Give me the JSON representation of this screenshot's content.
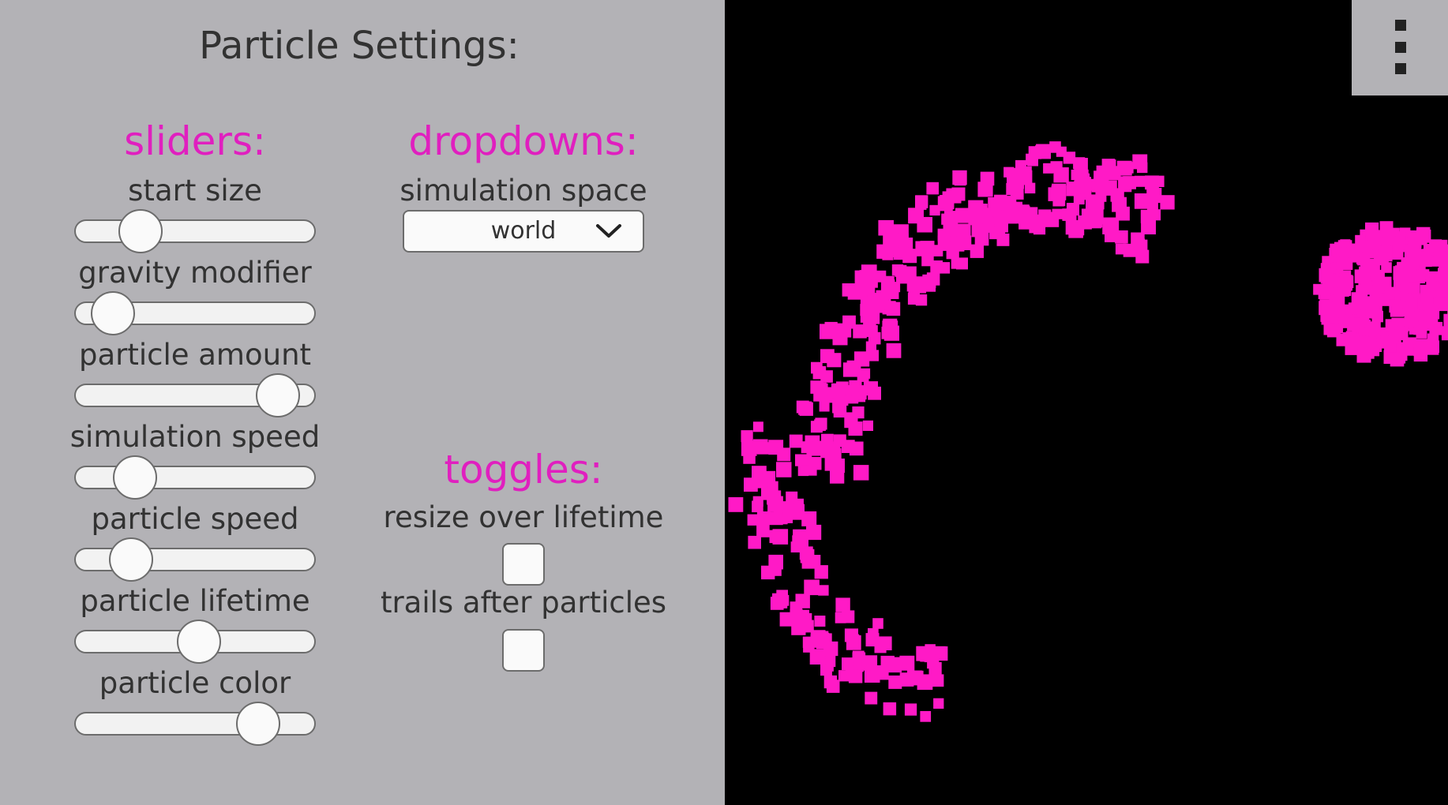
{
  "panel": {
    "title": "Particle Settings:"
  },
  "sliders": {
    "title": "sliders:",
    "items": [
      {
        "label": "start size",
        "value": 0.22
      },
      {
        "label": "gravity modifier",
        "value": 0.08
      },
      {
        "label": "particle amount",
        "value": 0.91
      },
      {
        "label": "simulation speed",
        "value": 0.19
      },
      {
        "label": "particle speed",
        "value": 0.17
      },
      {
        "label": "particle lifetime",
        "value": 0.51
      },
      {
        "label": "particle color",
        "value": 0.81
      }
    ]
  },
  "dropdowns": {
    "title": "dropdowns:",
    "label": "simulation space",
    "value": "world",
    "icon": "chevron-down-icon"
  },
  "toggles": {
    "title": "toggles:",
    "items": [
      {
        "label": "resize over lifetime",
        "checked": false
      },
      {
        "label": "trails after particles",
        "checked": false
      }
    ]
  },
  "viewport": {
    "background": "#000000",
    "particle_color": "#ff1ac6",
    "menu_icon": "kebab-menu-icon"
  },
  "colors": {
    "panel_bg": "#b3b2b6",
    "accent": "#e01fbf",
    "text": "#323232"
  }
}
